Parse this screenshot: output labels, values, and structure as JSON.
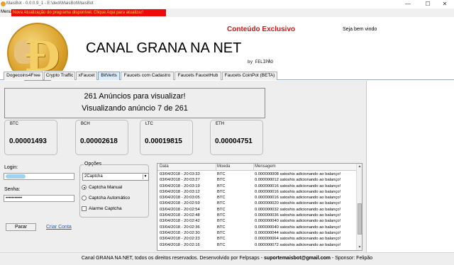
{
  "window": {
    "title": "MaisBot - 0.0.0.9_1 - E:\\dedi\\MaisBot\\MaisBot",
    "minimize": "—",
    "maximize": "☐",
    "close": "✕"
  },
  "menubar": {
    "menu_label": "Menu",
    "banner": "Nova Atualização do programa disponível. Clique Aqui para atualizar!"
  },
  "header": {
    "title": "CANAL GRANA NA NET",
    "author": "by FELIPÃO",
    "exclusive": "Conteúdo Exclusivo",
    "welcome": "Seja bem vindo"
  },
  "tabs": [
    {
      "label": "Dogecoins4Free"
    },
    {
      "label": "Crypto Traffic"
    },
    {
      "label": "xFaucet"
    },
    {
      "label": "BitVerts"
    },
    {
      "label": "Faucets com Cadastro"
    },
    {
      "label": "Faucets FaucetHub"
    },
    {
      "label": "Faucets CoinPot (BETA)"
    }
  ],
  "ads": {
    "line1": "261 Anúncios para visualizar!",
    "line2": "Visualizando anúncio 7 de 261"
  },
  "balances": [
    {
      "label": "BTC",
      "value": "0.00001493"
    },
    {
      "label": "BCH",
      "value": "0.00002618"
    },
    {
      "label": "LTC",
      "value": "0.00019815"
    },
    {
      "label": "ETH",
      "value": "0.00004751"
    }
  ],
  "form": {
    "login_label": "Login:",
    "login_value": "",
    "senha_label": "Senha:",
    "senha_value": "•••••••••••",
    "stop_button": "Parar",
    "create_account": "Criar Conta"
  },
  "options": {
    "title": "Opções",
    "captcha_select": "2Captcha",
    "captcha_manual": "Captcha Manual",
    "captcha_auto": "Captcha Automático",
    "alarm": "Alarme Captcha",
    "selected": "Captcha Manual"
  },
  "log": {
    "columns": [
      "Data",
      "Moeda",
      "Mensagem"
    ],
    "rows": [
      [
        "03/04/2018 - 20:03:33",
        "BTC",
        "0.000000008 satoshis adicionando ao balanço!"
      ],
      [
        "03/04/2018 - 20:03:27",
        "BTC",
        "0.000000012 satoshis adicionando ao balanço!"
      ],
      [
        "03/04/2018 - 20:03:19",
        "BTC",
        "0.000000016 satoshis adicionando ao balanço!"
      ],
      [
        "03/04/2018 - 20:03:12",
        "BTC",
        "0.000000016 satoshis adicionando ao balanço!"
      ],
      [
        "03/04/2018 - 20:03:05",
        "BTC",
        "0.000000016 satoshis adicionando ao balanço!"
      ],
      [
        "03/04/2018 - 20:02:59",
        "BTC",
        "0.000000020 satoshis adicionando ao balanço!"
      ],
      [
        "03/04/2018 - 20:02:54",
        "BTC",
        "0.000000032 satoshis adicionando ao balanço!"
      ],
      [
        "03/04/2018 - 20:02:48",
        "BTC",
        "0.000000036 satoshis adicionando ao balanço!"
      ],
      [
        "03/04/2018 - 20:02:42",
        "BTC",
        "0.000000040 satoshis adicionando ao balanço!"
      ],
      [
        "03/04/2018 - 20:02:36",
        "BTC",
        "0.000000040 satoshis adicionando ao balanço!"
      ],
      [
        "03/04/2018 - 20:02:30",
        "BTC",
        "0.000000044 satoshis adicionando ao balanço!"
      ],
      [
        "03/04/2018 - 20:02:23",
        "BTC",
        "0.000000064 satoshis adicionando ao balanço!"
      ],
      [
        "03/04/2018 - 20:02:16",
        "BTC",
        "0.000000072 satoshis adicionando ao balanço!"
      ]
    ]
  },
  "footer": {
    "text": "Canal GRANA NA NET, todos os direitos reservados. Desenvolvido por Felpsaps - ",
    "email": "suportemaisbot@gmail.com",
    "sponsor": " - Sponsor: Felipão"
  },
  "colors": {
    "banner_bg": "#ee0a0a",
    "exclusive_text": "#d21414",
    "active_tab": "#dcecfc",
    "link": "#2a5db0"
  }
}
